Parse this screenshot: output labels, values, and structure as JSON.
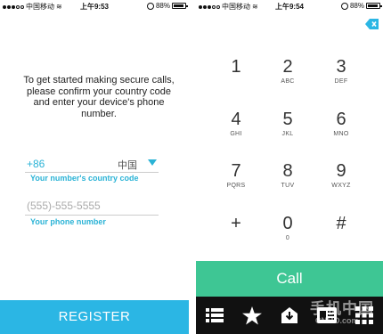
{
  "left_screen": {
    "status": {
      "carrier": "中国移动",
      "time": "上午9:53",
      "battery": "88%"
    },
    "intro_text": "To get started making secure calls, please confirm your country code and enter your device's phone number.",
    "country_code": "+86",
    "country_name": "中国",
    "country_code_label": "Your number's country code",
    "phone_placeholder": "(555)-555-5555",
    "phone_label": "Your phone number",
    "register_label": "REGISTER"
  },
  "right_screen": {
    "status": {
      "carrier": "中国移动",
      "time": "上午9:54",
      "battery": "88%"
    },
    "keys": [
      {
        "digit": "1",
        "letters": ""
      },
      {
        "digit": "2",
        "letters": "ABC"
      },
      {
        "digit": "3",
        "letters": "DEF"
      },
      {
        "digit": "4",
        "letters": "GHI"
      },
      {
        "digit": "5",
        "letters": "JKL"
      },
      {
        "digit": "6",
        "letters": "MNO"
      },
      {
        "digit": "7",
        "letters": "PQRS"
      },
      {
        "digit": "8",
        "letters": "TUV"
      },
      {
        "digit": "9",
        "letters": "WXYZ"
      },
      {
        "digit": "+",
        "letters": ""
      },
      {
        "digit": "0",
        "letters": "0"
      },
      {
        "digit": "#",
        "letters": ""
      }
    ],
    "call_label": "Call",
    "tabs": [
      "list-icon",
      "star-icon",
      "download-icon",
      "contacts-icon",
      "keypad-icon"
    ],
    "watermark": {
      "text": "手机中国",
      "sub": "CNMO.com"
    }
  },
  "colors": {
    "accent_blue": "#2bb6e4",
    "call_green": "#3ec694",
    "tabbar": "#111111"
  }
}
